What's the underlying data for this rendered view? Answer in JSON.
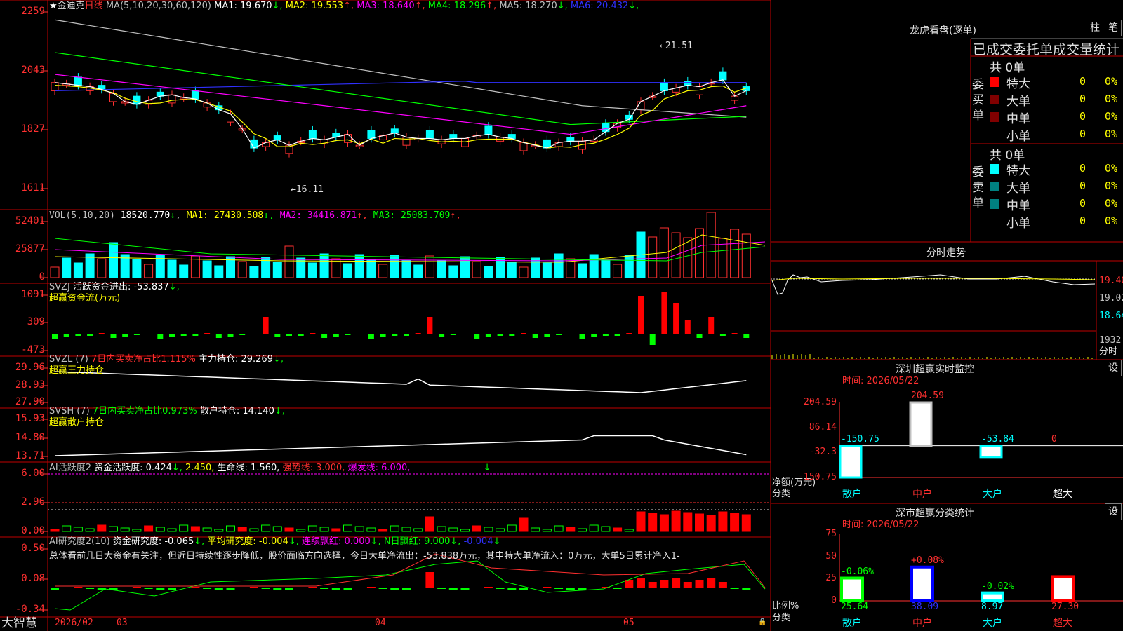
{
  "stock": {
    "name": "金迪克",
    "period": "日线",
    "ma_label": "MA(5,10,20,30,60,120)",
    "ma_values": [
      {
        "name": "MA1:",
        "value": "19.670",
        "arrow": "↓",
        "color": "#ffffff"
      },
      {
        "name": "MA2:",
        "value": "19.553",
        "arrow": "↑",
        "color": "#ffff00"
      },
      {
        "name": "MA3:",
        "value": "18.640",
        "arrow": "↑",
        "color": "#ff00ff"
      },
      {
        "name": "MA4:",
        "value": "18.296",
        "arrow": "↑",
        "color": "#00ff00"
      },
      {
        "name": "MA5:",
        "value": "18.270",
        "arrow": "↓",
        "color": "#c0c0c0"
      },
      {
        "name": "MA6:",
        "value": "20.432",
        "arrow": "↓",
        "color": "#3030ff"
      }
    ],
    "high_marker": "21.51",
    "low_marker": "16.11",
    "y_ticks": [
      "2259",
      "2043",
      "1827",
      "1611"
    ]
  },
  "vol": {
    "label": "VOL(5,10,20)",
    "value": "18520.770",
    "arrow": "↓",
    "ma": [
      {
        "name": "MA1:",
        "value": "27430.508",
        "arrow": "↓",
        "color": "#ffff00"
      },
      {
        "name": "MA2:",
        "value": "34416.871",
        "arrow": "↑",
        "color": "#ff00ff"
      },
      {
        "name": "MA3:",
        "value": "25083.709",
        "arrow": "↑",
        "color": "#00ff00"
      }
    ],
    "y_ticks": [
      "52401",
      "25877",
      "0"
    ]
  },
  "svzj": {
    "label": "SVZJ",
    "text": "活跃资金进出: -53.837",
    "arrow": "↓,",
    "sub": "超赢资金流(万元)",
    "y_ticks": [
      "1091",
      "309",
      "-473"
    ]
  },
  "svzl": {
    "label": "SVZL (7)",
    "text1": "7日内买卖净占比1.115%",
    "text2": "主力持仓: 29.269",
    "arrow": "↓,",
    "sub": "超赢王力持仓",
    "y_ticks": [
      "29.96",
      "28.93",
      "27.90"
    ]
  },
  "svsh": {
    "label": "SVSH (7)",
    "text1": "7日内买卖净占比0.973%",
    "text2": "散户持仓: 14.140",
    "arrow": "↓,",
    "sub": "超赢散户持仓",
    "y_ticks": [
      "15.93",
      "14.80",
      "13.71"
    ]
  },
  "ai_active": {
    "label": "AI活跃度2",
    "t1": "资金活跃度: 0.424",
    "a1": "↓,",
    "t2": "2.450,",
    "t3": "生命线: 1.560,",
    "t4": "强势线: 3.000,",
    "t5": "爆发线: 6.000,",
    "y_ticks": [
      "6.00",
      "2.96",
      "0.00"
    ]
  },
  "ai_research": {
    "label": "AI研究度2(10)",
    "t1": "资金研究度: -0.065",
    "a1": "↓,",
    "t2": "平均研究度: -0.004",
    "a2": "↓,",
    "t3": "连续飘红: 0.000",
    "a3": "↓,",
    "t4": "N日飘红: 9.000",
    "a4": "↓,",
    "t5": "-0.004",
    "a5": "↓",
    "summary": "总体看前几日大资金有关注，但近日持续性逐步降低，股价面临方向选择，今日大单净流出：-53.838万元，其中特大单净流入：0万元，大单5日累计净入1-",
    "y_ticks": [
      "0.50",
      "0.08",
      "-0.34"
    ]
  },
  "date_axis": {
    "logo": "大智慧",
    "labels": [
      "2026/02",
      "03",
      "04",
      "05"
    ]
  },
  "longhu": {
    "title": "龙虎看盘(逐单)",
    "btn1": "柱",
    "btn2": "笔",
    "subtitle": "已成交委托单成交量统计",
    "buy_title": "委买单",
    "sell_title": "委卖单",
    "buy_total": "共 0单",
    "sell_total": "共 0单",
    "buy_rows": [
      {
        "label": "特大",
        "count": "0",
        "pct": "0%",
        "color": "#ff0000"
      },
      {
        "label": "大单",
        "count": "0",
        "pct": "0%",
        "color": "#800000"
      },
      {
        "label": "中单",
        "count": "0",
        "pct": "0%",
        "color": "#800000"
      },
      {
        "label": "小单",
        "count": "0",
        "pct": "0%",
        "color": ""
      }
    ],
    "sell_rows": [
      {
        "label": "特大",
        "count": "0",
        "pct": "0%",
        "color": "#00ffff"
      },
      {
        "label": "大单",
        "count": "0",
        "pct": "0%",
        "color": "#008080"
      },
      {
        "label": "中单",
        "count": "0",
        "pct": "0%",
        "color": "#008080"
      },
      {
        "label": "小单",
        "count": "0",
        "pct": "0%",
        "color": ""
      }
    ]
  },
  "intraday": {
    "title": "分时走势",
    "y_ticks": [
      "19.40",
      "19.02",
      "18.64"
    ],
    "vol_tick": "1932",
    "vol_label": "分时"
  },
  "sz_monitor": {
    "title": "深圳超赢实时监控",
    "btn": "设",
    "time": "时间: 2026/05/22",
    "y_ticks": [
      "204.59",
      "86.14",
      "-32.3",
      "-150.75"
    ],
    "ylabel1": "净额(万元)",
    "ylabel2": "分类",
    "categories": [
      "散户",
      "中户",
      "大户",
      "超大"
    ],
    "values": [
      -150.75,
      204.59,
      -53.84,
      0
    ],
    "value_labels": [
      "-150.75",
      "204.59",
      "-53.84",
      "0"
    ]
  },
  "sz_classify": {
    "title": "深市超赢分类统计",
    "btn": "设",
    "time": "时间: 2026/05/22",
    "y_ticks": [
      "75",
      "50",
      "25",
      "0"
    ],
    "ylabel1": "比例%",
    "ylabel2": "分类",
    "categories": [
      "散户",
      "中户",
      "大户",
      "超大"
    ],
    "values": [
      25.64,
      38.09,
      8.97,
      27.3
    ],
    "value_labels": [
      "25.64",
      "38.09",
      "8.97",
      "27.30"
    ],
    "changes": [
      "-0.06%",
      "+0.08%",
      "-0.02%",
      ""
    ]
  },
  "chart_data": [
    {
      "type": "bar",
      "title": "深圳超赢实时监控",
      "ylabel": "净额(万元)",
      "xlabel": "分类",
      "categories": [
        "散户",
        "中户",
        "大户",
        "超大"
      ],
      "values": [
        -150.75,
        204.59,
        -53.84,
        0
      ],
      "ylim": [
        -150.75,
        204.59
      ]
    },
    {
      "type": "bar",
      "title": "深市超赢分类统计",
      "ylabel": "比例%",
      "xlabel": "分类",
      "categories": [
        "散户",
        "中户",
        "大户",
        "超大"
      ],
      "values": [
        25.64,
        38.09,
        8.97,
        27.3
      ],
      "ylim": [
        0,
        75
      ]
    }
  ],
  "colors": {
    "up": "#ff3030",
    "down": "#00ffff",
    "grid": "#c00000",
    "axis_text": "#ff3030"
  }
}
